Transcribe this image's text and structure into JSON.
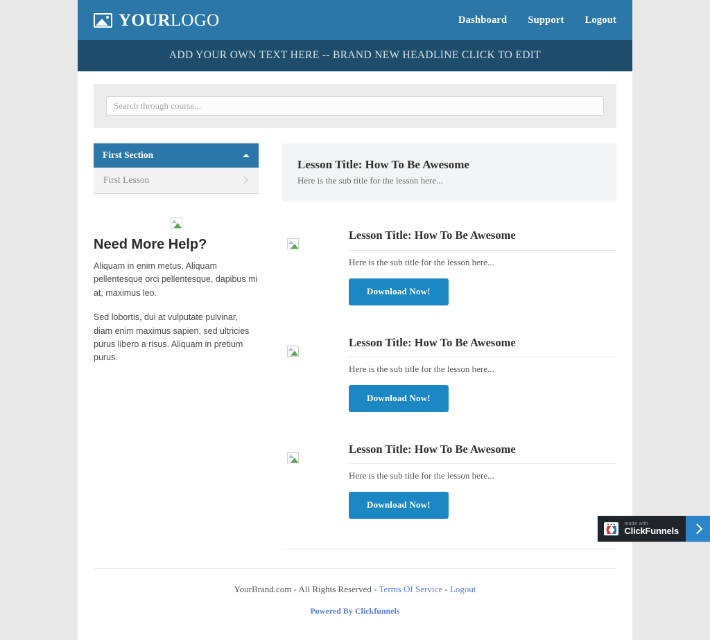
{
  "header": {
    "logo": {
      "icon": "image-placeholder-icon",
      "bold_text": "YOUR",
      "light_text": "LOGO"
    },
    "nav": [
      {
        "label": "Dashboard"
      },
      {
        "label": "Support"
      },
      {
        "label": "Logout"
      }
    ]
  },
  "headline": {
    "text": "ADD YOUR OWN TEXT HERE -- BRAND NEW HEADLINE CLICK TO EDIT"
  },
  "search": {
    "value": "",
    "placeholder": "Search through course..."
  },
  "sidebar": {
    "section": {
      "label": "First Section",
      "caret_icon": "caret-up-icon",
      "expanded": true
    },
    "lessons": [
      {
        "label": "First Lesson",
        "chevron_icon": "chevron-right-icon"
      }
    ]
  },
  "help": {
    "image_icon": "broken-image-icon",
    "title": "Need More Help?",
    "paragraphs": [
      "Aliquam in enim metus. Aliquam pellentesque orci pellentesque, dapibus mi at, maximus leo.",
      "Sed lobortis, dui at vulputate pulvinar, diam enim maximus sapien, sed ultricies purus libero a risus. Aliquam in pretium purus."
    ]
  },
  "lesson_header": {
    "title_label": "Lesson Title:",
    "title_value": "How To Be Awesome",
    "subtitle": "Here is the sub title for the lesson here..."
  },
  "downloads": [
    {
      "image_icon": "broken-image-icon",
      "title_label": "Lesson Title:",
      "title_value": "How To Be Awesome",
      "subtitle": "Here is the sub title for the lesson here...",
      "button_label": "Download Now!"
    },
    {
      "image_icon": "broken-image-icon",
      "title_label": "Lesson Title:",
      "title_value": "How To Be Awesome",
      "subtitle": "Here is the sub title for the lesson here...",
      "button_label": "Download Now!"
    },
    {
      "image_icon": "broken-image-icon",
      "title_label": "Lesson Title:",
      "title_value": "How To Be Awesome",
      "subtitle": "Here is the sub title for the lesson here...",
      "button_label": "Download Now!"
    }
  ],
  "footer": {
    "copyright_text": "YourBrand.com - All Rights Reserved - ",
    "terms_label": "Terms Of Service",
    "separator": " - ",
    "logout_label": "Logout",
    "powered_by_label": "Powered By Clickfunnels"
  },
  "badge": {
    "made_with": "made with",
    "brand": "ClickFunnels",
    "logo_icon": "clickfunnels-logo-icon",
    "arrow_icon": "chevron-right-icon"
  },
  "colors": {
    "header_blue": "#2b77a8",
    "headline_blue": "#1d4d6b",
    "button_blue": "#1b87c3",
    "link_blue": "#5b7fd4",
    "page_bg": "#e9e9e9",
    "panel_gray": "#ececec",
    "card_gray": "#f3f4f5",
    "badge_dark": "#20242b"
  }
}
